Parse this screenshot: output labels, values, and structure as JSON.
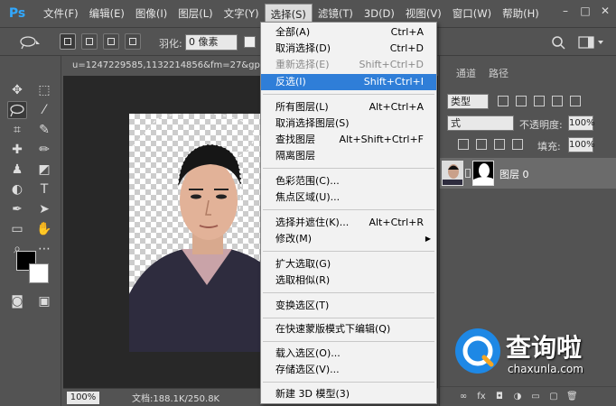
{
  "app": {
    "logo": "Ps"
  },
  "menubar": {
    "items": [
      "文件(F)",
      "编辑(E)",
      "图像(I)",
      "图层(L)",
      "文字(Y)",
      "选择(S)",
      "滤镜(T)",
      "3D(D)",
      "视图(V)",
      "窗口(W)",
      "帮助(H)"
    ],
    "active_index": 5
  },
  "options": {
    "feather_label": "羽化:",
    "feather_value": "0 像素"
  },
  "document": {
    "tab_title": "u=1247229585,1132214856&fm=27&gp="
  },
  "status": {
    "zoom": "100%",
    "doc_size": "文档:188.1K/250.8K"
  },
  "panels": {
    "tabs": [
      "通道",
      "路径"
    ],
    "kind_select": "类型",
    "blend_mode": "式",
    "opacity_label": "不透明度:",
    "opacity_value": "100%",
    "fill_label": "填充:",
    "fill_value": "100%",
    "layer_name": "图层 0"
  },
  "select_menu": {
    "items": [
      {
        "label": "全部(A)",
        "shortcut": "Ctrl+A",
        "disabled": false
      },
      {
        "label": "取消选择(D)",
        "shortcut": "Ctrl+D",
        "disabled": false
      },
      {
        "label": "重新选择(E)",
        "shortcut": "Shift+Ctrl+D",
        "disabled": true
      },
      {
        "label": "反选(I)",
        "shortcut": "Shift+Ctrl+I",
        "highlighted": true
      },
      {
        "label": "所有图层(L)",
        "shortcut": "Alt+Ctrl+A",
        "disabled": false
      },
      {
        "label": "取消选择图层(S)",
        "shortcut": "",
        "disabled": false
      },
      {
        "label": "查找图层",
        "shortcut": "Alt+Shift+Ctrl+F",
        "disabled": false
      },
      {
        "label": "隔离图层",
        "shortcut": "",
        "disabled": false
      },
      {
        "label": "色彩范围(C)...",
        "shortcut": "",
        "disabled": false
      },
      {
        "label": "焦点区域(U)...",
        "shortcut": "",
        "disabled": false
      },
      {
        "label": "选择并遮住(K)...",
        "shortcut": "Alt+Ctrl+R",
        "disabled": false
      },
      {
        "label": "修改(M)",
        "shortcut": "",
        "submenu": true
      },
      {
        "label": "扩大选取(G)",
        "shortcut": "",
        "disabled": false
      },
      {
        "label": "选取相似(R)",
        "shortcut": "",
        "disabled": false
      },
      {
        "label": "变换选区(T)",
        "shortcut": "",
        "disabled": false
      },
      {
        "label": "在快速蒙版模式下编辑(Q)",
        "shortcut": "",
        "disabled": false
      },
      {
        "label": "载入选区(O)...",
        "shortcut": "",
        "disabled": false
      },
      {
        "label": "存储选区(V)...",
        "shortcut": "",
        "disabled": false
      },
      {
        "label": "新建 3D 模型(3)",
        "shortcut": "",
        "disabled": false
      }
    ]
  },
  "watermark": {
    "title": "查询啦",
    "subtitle": "chaxunla.com"
  },
  "colors": {
    "ui_bg": "#535353",
    "highlight": "#2f7ed8",
    "ps_blue": "#31a8ff",
    "watermark_blue": "#1e88e5"
  }
}
